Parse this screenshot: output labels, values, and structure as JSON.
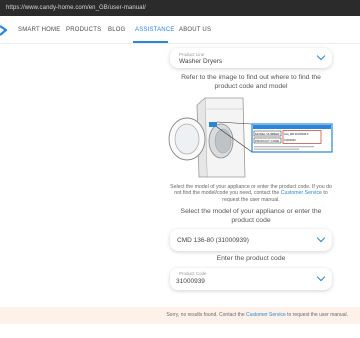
{
  "browser": {
    "url": "https://www.candy-home.com/en_GB/user-manual/"
  },
  "nav": {
    "items": [
      {
        "label": "SMART HOME",
        "active": false
      },
      {
        "label": "PRODUCTS",
        "active": false
      },
      {
        "label": "BLOG",
        "active": false
      },
      {
        "label": "ASSISTANCE",
        "active": true
      },
      {
        "label": "ABOUT US",
        "active": false
      }
    ],
    "accent_color": "#2a86d6"
  },
  "product_line": {
    "label": "Product Line",
    "value": "Washer Dryers"
  },
  "instructions": {
    "find_code": "Refer to the image to find out where to find the product code and model",
    "select_help_prefix": "Select the model of your appliance or enter the product code. If you do not find the model/code you need, contact the ",
    "select_help_link": "Customer Service",
    "select_help_suffix": " to request the user manual.",
    "select_title": "Select the model of your appliance or enter the product code",
    "enter_code_title": "Enter the product code"
  },
  "model_select": {
    "value": "CMD 136-80 (31000939)"
  },
  "product_code": {
    "label": "Product Code",
    "value": "31000939"
  },
  "label_sticker": {
    "rows": [
      {
        "key": "MODEL NUMBER",
        "value": "Ana_MB 31000939.0"
      },
      {
        "key": "PRODUCT CODE",
        "value": "31000939"
      }
    ]
  },
  "error": {
    "prefix": "Sorry, no results found. Contact the ",
    "link": "Customer Service",
    "suffix": " to request the user manual."
  }
}
